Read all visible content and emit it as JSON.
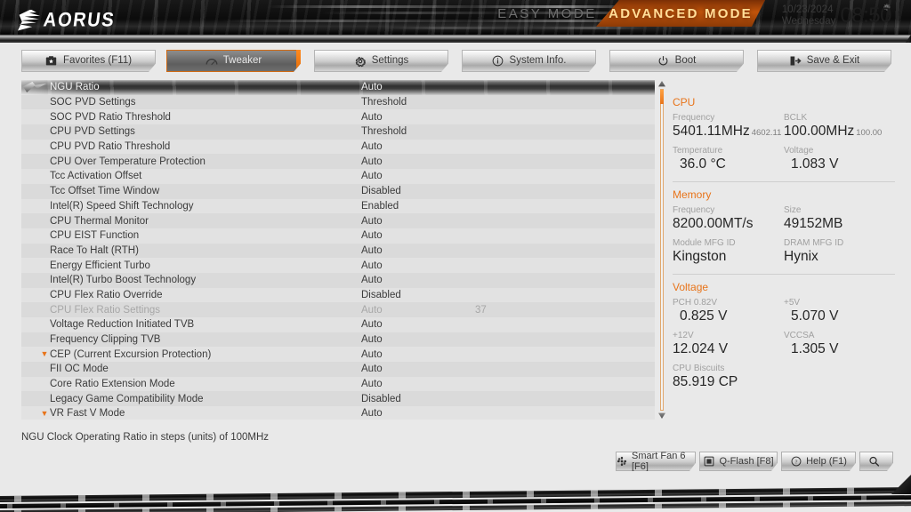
{
  "header": {
    "brand": "AORUS",
    "mode_easy": "EASY MODE",
    "mode_advanced": "ADVANCED MODE",
    "date": "10/23/2024",
    "weekday": "Wednesday",
    "time": "08:50",
    "gear_icon": "gear-icon"
  },
  "tabs": [
    {
      "label": "Favorites (F11)",
      "icon": "star-box-icon",
      "active": false
    },
    {
      "label": "Tweaker",
      "icon": "gauge-icon",
      "active": true
    },
    {
      "label": "Settings",
      "icon": "gear-icon",
      "active": false
    },
    {
      "label": "System Info.",
      "icon": "info-icon",
      "active": false
    },
    {
      "label": "Boot",
      "icon": "power-icon",
      "active": false
    },
    {
      "label": "Save & Exit",
      "icon": "exit-icon",
      "active": false
    }
  ],
  "settings": {
    "rows": [
      {
        "name": "NGU Ratio",
        "value": "Auto",
        "num": "",
        "selected": true,
        "arrow": false,
        "dim": false
      },
      {
        "name": "SOC PVD Settings",
        "value": "Threshold",
        "num": "",
        "selected": false,
        "arrow": false,
        "dim": false
      },
      {
        "name": "SOC PVD Ratio Threshold",
        "value": "Auto",
        "num": "",
        "selected": false,
        "arrow": false,
        "dim": false
      },
      {
        "name": "CPU PVD Settings",
        "value": "Threshold",
        "num": "",
        "selected": false,
        "arrow": false,
        "dim": false
      },
      {
        "name": "CPU PVD Ratio Threshold",
        "value": "Auto",
        "num": "",
        "selected": false,
        "arrow": false,
        "dim": false
      },
      {
        "name": "CPU Over Temperature Protection",
        "value": "Auto",
        "num": "",
        "selected": false,
        "arrow": false,
        "dim": false
      },
      {
        "name": "Tcc Activation Offset",
        "value": "Auto",
        "num": "",
        "selected": false,
        "arrow": false,
        "dim": false
      },
      {
        "name": "Tcc Offset Time Window",
        "value": "Disabled",
        "num": "",
        "selected": false,
        "arrow": false,
        "dim": false
      },
      {
        "name": "Intel(R) Speed Shift Technology",
        "value": "Enabled",
        "num": "",
        "selected": false,
        "arrow": false,
        "dim": false
      },
      {
        "name": "CPU Thermal Monitor",
        "value": "Auto",
        "num": "",
        "selected": false,
        "arrow": false,
        "dim": false
      },
      {
        "name": "CPU EIST Function",
        "value": "Auto",
        "num": "",
        "selected": false,
        "arrow": false,
        "dim": false
      },
      {
        "name": "Race To Halt (RTH)",
        "value": "Auto",
        "num": "",
        "selected": false,
        "arrow": false,
        "dim": false
      },
      {
        "name": "Energy Efficient Turbo",
        "value": "Auto",
        "num": "",
        "selected": false,
        "arrow": false,
        "dim": false
      },
      {
        "name": "Intel(R) Turbo Boost Technology",
        "value": "Auto",
        "num": "",
        "selected": false,
        "arrow": false,
        "dim": false
      },
      {
        "name": "CPU Flex Ratio Override",
        "value": "Disabled",
        "num": "",
        "selected": false,
        "arrow": false,
        "dim": false
      },
      {
        "name": "CPU Flex Ratio Settings",
        "value": "Auto",
        "num": "37",
        "selected": false,
        "arrow": false,
        "dim": true
      },
      {
        "name": "Voltage Reduction Initiated TVB",
        "value": "Auto",
        "num": "",
        "selected": false,
        "arrow": false,
        "dim": false
      },
      {
        "name": "Frequency Clipping TVB",
        "value": "Auto",
        "num": "",
        "selected": false,
        "arrow": false,
        "dim": false
      },
      {
        "name": "CEP (Current Excursion Protection)",
        "value": "Auto",
        "num": "",
        "selected": false,
        "arrow": true,
        "dim": false
      },
      {
        "name": "FII OC Mode",
        "value": "Auto",
        "num": "",
        "selected": false,
        "arrow": false,
        "dim": false
      },
      {
        "name": "Core Ratio Extension Mode",
        "value": "Auto",
        "num": "",
        "selected": false,
        "arrow": false,
        "dim": false
      },
      {
        "name": "Legacy Game Compatibility Mode",
        "value": "Disabled",
        "num": "",
        "selected": false,
        "arrow": false,
        "dim": false
      },
      {
        "name": "VR Fast V Mode",
        "value": "Auto",
        "num": "",
        "selected": false,
        "arrow": true,
        "dim": false
      }
    ]
  },
  "help_text": "NGU Clock Operating Ratio in steps (units) of 100MHz",
  "panel": {
    "accent_color": "#e8741a",
    "cpu": {
      "title": "CPU",
      "frequency_label": "Frequency",
      "frequency_value": "5401.11MHz",
      "frequency_sub": "4602.11",
      "bclk_label": "BCLK",
      "bclk_value": "100.00MHz",
      "bclk_sub": "100.00",
      "temperature_label": "Temperature",
      "temperature_value": "36.0 °C",
      "voltage_label": "Voltage",
      "voltage_value": "1.083 V"
    },
    "memory": {
      "title": "Memory",
      "frequency_label": "Frequency",
      "frequency_value": "8200.00MT/s",
      "size_label": "Size",
      "size_value": "49152MB",
      "module_mfg_label": "Module MFG ID",
      "module_mfg_value": "Kingston",
      "dram_mfg_label": "DRAM MFG ID",
      "dram_mfg_value": "Hynix"
    },
    "voltage": {
      "title": "Voltage",
      "pch_label": "PCH 0.82V",
      "pch_value": "0.825 V",
      "p5v_label": "+5V",
      "p5v_value": "5.070 V",
      "p12v_label": "+12V",
      "p12v_value": "12.024 V",
      "vccsa_label": "VCCSA",
      "vccsa_value": "1.305 V",
      "biscuits_label": "CPU Biscuits",
      "biscuits_value": "85.919 CP"
    }
  },
  "bottom_buttons": [
    {
      "label": "Smart Fan 6 [F6]",
      "icon": "fan-icon"
    },
    {
      "label": "Q-Flash [F8]",
      "icon": "chip-icon"
    },
    {
      "label": "Help (F1)",
      "icon": "question-icon"
    },
    {
      "label": "",
      "icon": "search-icon"
    }
  ]
}
